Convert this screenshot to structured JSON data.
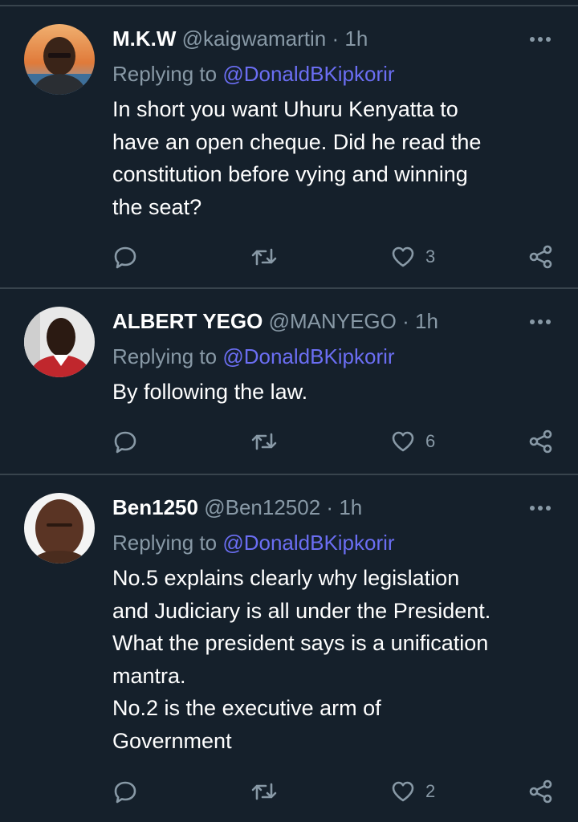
{
  "tweets": [
    {
      "name": "M.K.W",
      "handle": "@kaigwamartin",
      "separator": "·",
      "time": "1h",
      "replying_prefix": "Replying to",
      "replying_to": "@DonaldBKipkorir",
      "text_lines": [
        "In short you want Uhuru Kenyatta to",
        "have an open cheque. Did he read the",
        "constitution before vying and winning",
        "the seat?"
      ],
      "likes": "3",
      "avatar": "profile-photo-man-sunset"
    },
    {
      "name": "ALBERT YEGO",
      "handle": "@MANYEGO",
      "separator": "·",
      "time": "1h",
      "replying_prefix": "Replying to",
      "replying_to": "@DonaldBKipkorir",
      "text_lines": [
        "By following the law."
      ],
      "likes": "6",
      "avatar": "profile-photo-man-red-shirt"
    },
    {
      "name": "Ben1250",
      "handle": "@Ben12502",
      "separator": "·",
      "time": "1h",
      "replying_prefix": "Replying to",
      "replying_to": "@DonaldBKipkorir",
      "text_lines": [
        "No.5 explains clearly why legislation",
        "and Judiciary is all under the President.",
        "What the president says is a unification",
        "mantra.",
        "No.2 is the executive arm of",
        "Government"
      ],
      "likes": "2",
      "avatar": "profile-photo-man-white-bg"
    }
  ],
  "icons": {
    "reply": "reply-icon",
    "retweet": "retweet-icon",
    "like": "heart-icon",
    "share": "share-icon",
    "more": "more-options-icon"
  },
  "colors": {
    "background": "#15202b",
    "divider": "#38444d",
    "secondary_text": "#8899a6",
    "mention": "#6b6ef3",
    "primary_text": "#ffffff"
  }
}
